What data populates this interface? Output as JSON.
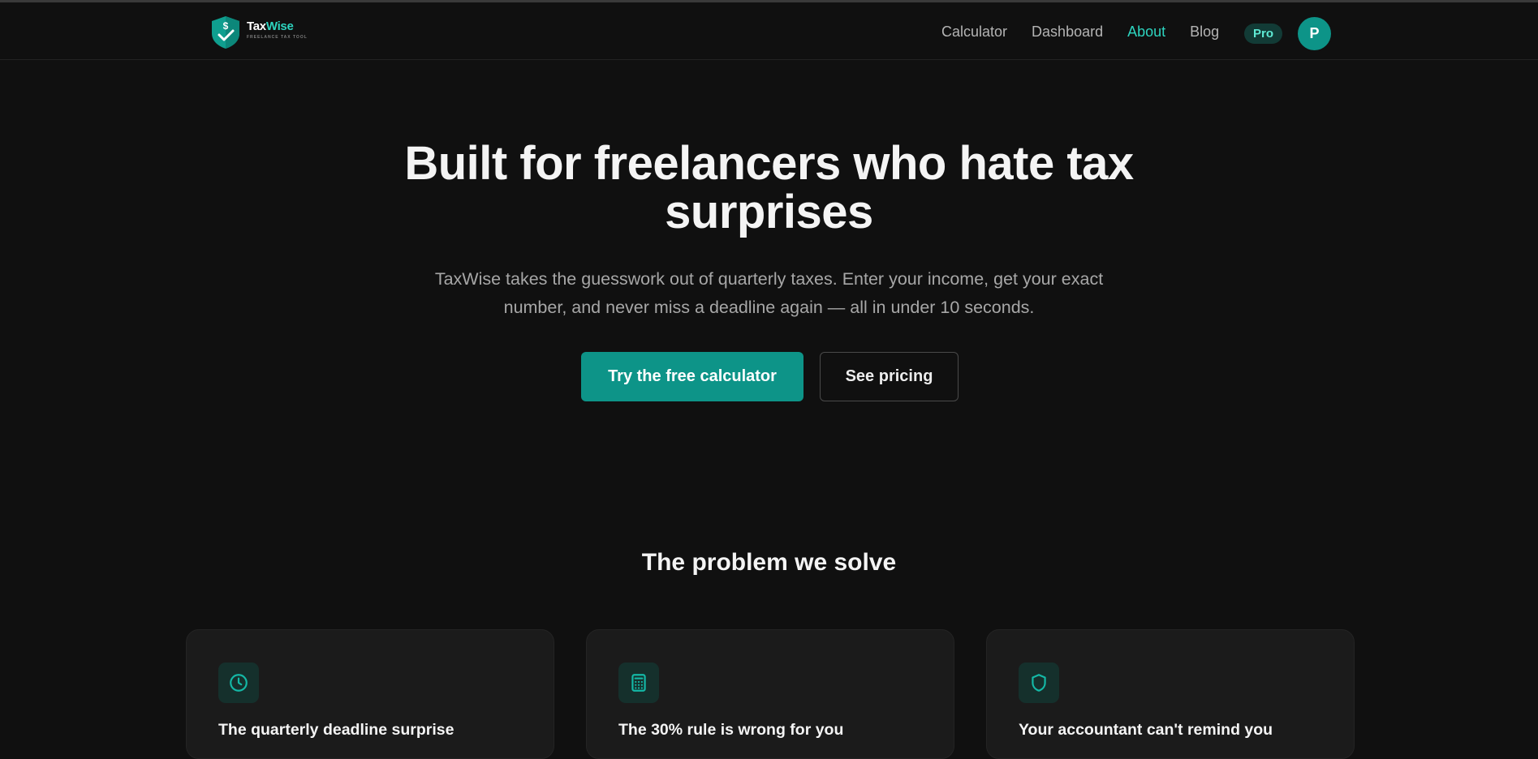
{
  "navbar": {
    "brand_part1": "Tax",
    "brand_part2": "Wise",
    "tagline": "FREELANCE TAX TOOL",
    "links": [
      {
        "label": "Calculator",
        "active": false
      },
      {
        "label": "Dashboard",
        "active": false
      },
      {
        "label": "About",
        "active": true
      },
      {
        "label": "Blog",
        "active": false
      }
    ],
    "pro_badge": "Pro",
    "avatar_initial": "P"
  },
  "hero": {
    "title": "Built for freelancers who hate tax surprises",
    "subtitle": "TaxWise takes the guesswork out of quarterly taxes. Enter your income, get your exact number, and never miss a deadline again — all in under 10 seconds.",
    "primary_cta": "Try the free calculator",
    "secondary_cta": "See pricing"
  },
  "problems": {
    "title": "The problem we solve",
    "cards": [
      {
        "icon": "clock-icon",
        "title": "The quarterly deadline surprise"
      },
      {
        "icon": "calculator-icon",
        "title": "The 30% rule is wrong for you"
      },
      {
        "icon": "shield-icon",
        "title": "Your accountant can't remind you"
      }
    ]
  },
  "colors": {
    "background": "#101010",
    "accent": "#0d9488",
    "accent_text": "#2dd4bf",
    "card": "#1b1b1b"
  }
}
